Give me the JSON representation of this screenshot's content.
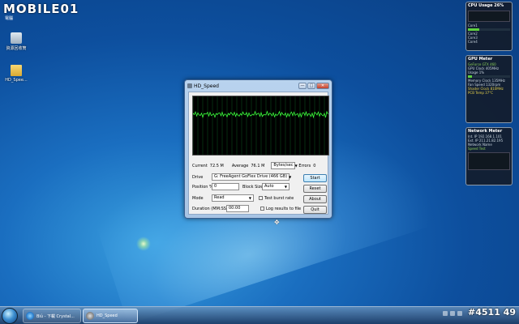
{
  "desktop": {
    "logo": "MOBILE01",
    "logo_sub": "電腦",
    "icons": [
      {
        "label": "資源回收筒"
      },
      {
        "label": "HD_Spee..."
      }
    ]
  },
  "gadgets": {
    "cpu": {
      "title": "CPU Usage",
      "percent": "26%",
      "lines": [
        "Core1",
        "Core2",
        "Core3",
        "Core4"
      ],
      "level": 0.26
    },
    "gpu": {
      "title": "GPU Meter",
      "subtitle": "GeForce GTX 460",
      "lines": [
        "GPU Clock 405MHz",
        "Usage 1%",
        "Memory Clock 135MHz",
        "Fan Speed 1320rpm",
        "Shader Clock 810MHz",
        "PCB Temp 37°C"
      ]
    },
    "network": {
      "title": "Network Meter",
      "lines": [
        "Int. IP 192.168.1.101",
        "Ext. IP 211.21.82.195",
        "Network Name",
        "Speed Test"
      ]
    }
  },
  "window": {
    "title": "HD_Speed",
    "buttons": {
      "minimize": "—",
      "maximize": "□",
      "close": "✕"
    },
    "stats": {
      "current_label": "Current",
      "current_value": "72.5 M",
      "average_label": "Average",
      "average_value": "76.1 M",
      "unit": "Bytes/sec",
      "errors_label": "Errors",
      "errors_value": "0"
    },
    "drive_label": "Drive",
    "drive_value": "G: FreeAgent GoFlex Drive (466 GB)",
    "position_label": "Position %",
    "position_value": "0",
    "block_label": "Block Size",
    "block_value": "Auto",
    "mode_label": "Mode",
    "mode_value": "Read",
    "test_burst": "Test burst rate",
    "log_results": "Log results to file",
    "duration_label": "Duration (MM:SS)",
    "duration_value": "00:00",
    "btn_start": "Start",
    "btn_reset": "Reset",
    "btn_about": "About",
    "btn_quit": "Quit"
  },
  "taskbar": {
    "tasks": [
      {
        "label": "Biủ - 下載 Crystal..."
      },
      {
        "label": "HD_Speed"
      }
    ]
  },
  "watermark": "#4511 49"
}
